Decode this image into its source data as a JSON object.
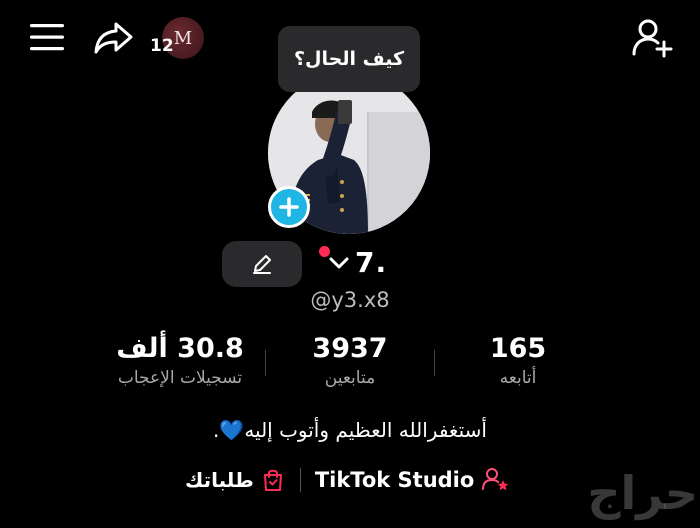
{
  "header": {
    "menu_icon": "hamburger-menu-icon",
    "share_icon": "share-arrow-icon",
    "notification_count": "12",
    "mini_avatar_letter": "M",
    "add_friend_icon": "add-person-icon"
  },
  "profile": {
    "note_bubble": "كيف الحال؟",
    "display_name": "7.",
    "username": "@y3.x8",
    "bio": "أستغفرالله العظيم وأتوب إليه",
    "bio_emoji": "💙",
    "bio_end": ".",
    "accent": "#1fb6e6",
    "live_dot_color": "#ff2b55"
  },
  "stats": {
    "following": {
      "value": "165",
      "label": "أتابعه"
    },
    "followers": {
      "value": "3937",
      "label": "متابعين"
    },
    "likes": {
      "value": "30.8 ألف",
      "label": "تسجيلات الإعجاب"
    }
  },
  "links": {
    "studio_label": "TikTok Studio",
    "orders_label": "طلباتك"
  },
  "watermark": "حراج"
}
